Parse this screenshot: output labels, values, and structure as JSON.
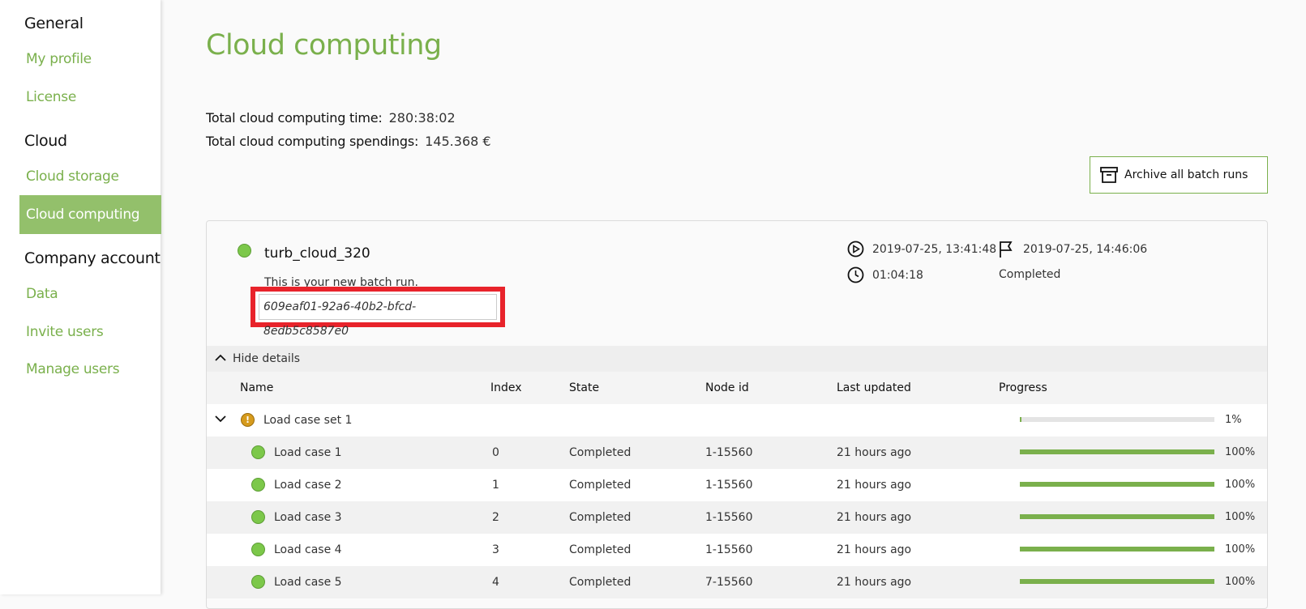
{
  "sidebar": {
    "sections": [
      {
        "title": "General",
        "items": [
          {
            "label": "My profile"
          },
          {
            "label": "License"
          }
        ]
      },
      {
        "title": "Cloud",
        "items": [
          {
            "label": "Cloud storage"
          },
          {
            "label": "Cloud computing",
            "active": true
          }
        ]
      },
      {
        "title": "Company account",
        "items": [
          {
            "label": "Data"
          },
          {
            "label": "Invite users"
          },
          {
            "label": "Manage users"
          }
        ]
      }
    ]
  },
  "page": {
    "title": "Cloud computing",
    "total_time_label": "Total cloud computing time:",
    "total_time_value": "280:38:02",
    "total_spend_label": "Total cloud computing spendings:",
    "total_spend_value": "145.368 €",
    "archive_label": "Archive all batch runs"
  },
  "run": {
    "name": "turb_cloud_320",
    "description": "This is your new batch run.",
    "id": "609eaf01-92a6-40b2-bfcd-8edb5c8587e0",
    "started": "2019-07-25, 13:41:48",
    "finished": "2019-07-25, 14:46:06",
    "duration": "01:04:18",
    "status": "Completed",
    "details_toggle": "Hide details",
    "status_color": "#7cc84a"
  },
  "table": {
    "headers": [
      "Name",
      "Index",
      "State",
      "Node id",
      "Last updated",
      "Progress"
    ],
    "group": {
      "name": "Load case set 1",
      "progress": 1,
      "progress_label": "1%",
      "status_color": "#d69b1d"
    },
    "rows": [
      {
        "name": "Load case 1",
        "index": "0",
        "state": "Completed",
        "node": "1-15560",
        "updated": "21 hours ago",
        "progress": 100,
        "progress_label": "100%"
      },
      {
        "name": "Load case 2",
        "index": "1",
        "state": "Completed",
        "node": "1-15560",
        "updated": "21 hours ago",
        "progress": 100,
        "progress_label": "100%"
      },
      {
        "name": "Load case 3",
        "index": "2",
        "state": "Completed",
        "node": "1-15560",
        "updated": "21 hours ago",
        "progress": 100,
        "progress_label": "100%"
      },
      {
        "name": "Load case 4",
        "index": "3",
        "state": "Completed",
        "node": "1-15560",
        "updated": "21 hours ago",
        "progress": 100,
        "progress_label": "100%"
      },
      {
        "name": "Load case 5",
        "index": "4",
        "state": "Completed",
        "node": "7-15560",
        "updated": "21 hours ago",
        "progress": 100,
        "progress_label": "100%"
      }
    ]
  },
  "colors": {
    "accent": "#7ab04c",
    "highlight": "#e8232b"
  }
}
